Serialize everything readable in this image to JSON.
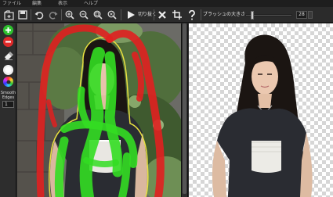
{
  "menu": {
    "file": "ファイル",
    "edit": "編集",
    "view": "表示",
    "help": "ヘルプ"
  },
  "toolbar": {
    "cut_label": "切り抜く",
    "brush_size_label": "ブラッシュの大きさ",
    "brush_size_value": "28",
    "brush_size_fraction": 0.12
  },
  "sidebar": {
    "smooth_edges_label_1": "Smooth",
    "smooth_edges_label_2": "Edges",
    "smooth_edges_value": "1"
  },
  "colors": {
    "keep_marker": "#33dd22",
    "remove_marker": "#e02020",
    "selection_outline": "#e8e040"
  }
}
